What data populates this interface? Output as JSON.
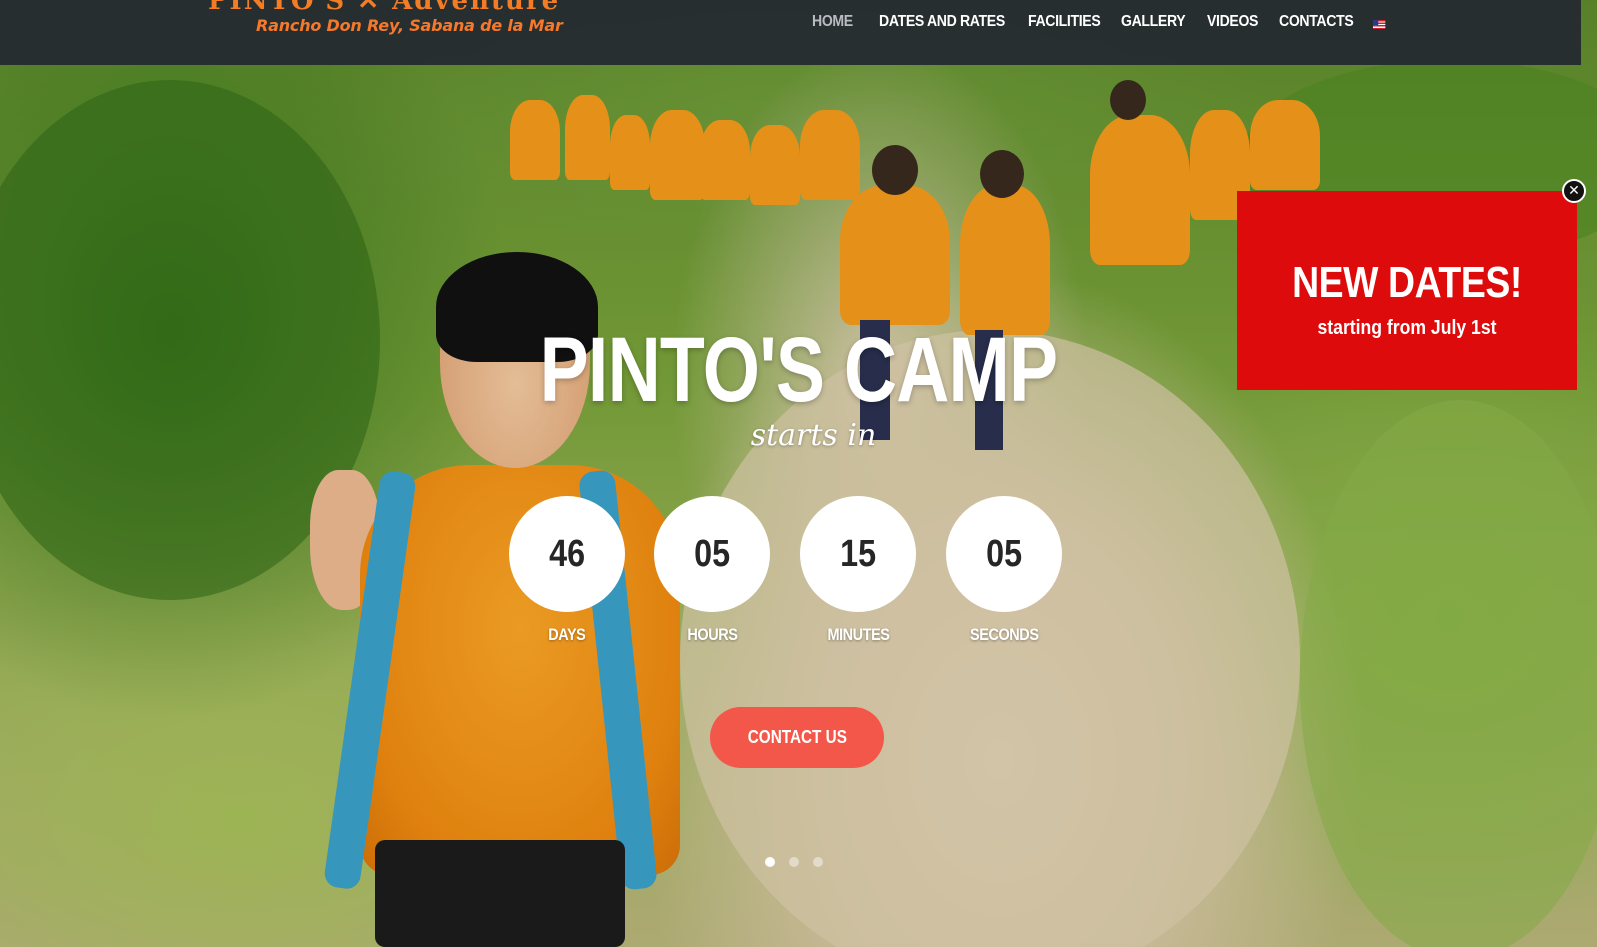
{
  "header": {
    "logo_sub": "Rancho Don Rey, Sabana de la Mar",
    "nav": [
      {
        "label": "HOME",
        "active": true
      },
      {
        "label": "DATES AND RATES",
        "active": false
      },
      {
        "label": "FACILITIES",
        "active": false
      },
      {
        "label": "GALLERY",
        "active": false
      },
      {
        "label": "VIDEOS",
        "active": false
      },
      {
        "label": "CONTACTS",
        "active": false
      }
    ],
    "language_icon": "us-flag-icon"
  },
  "hero": {
    "title": "PINTO'S CAMP",
    "subtitle": "starts in",
    "countdown": [
      {
        "value": "46",
        "label": "DAYS"
      },
      {
        "value": "05",
        "label": "HOURS"
      },
      {
        "value": "15",
        "label": "MINUTES"
      },
      {
        "value": "05",
        "label": "SECONDS"
      }
    ],
    "cta_label": "CONTACT US",
    "slider_dots": 3,
    "active_slide": 1
  },
  "promo": {
    "title": "NEW DATES!",
    "subtitle": "starting from July 1st",
    "close_icon": "close-icon",
    "color": "#dd0b0b"
  },
  "colors": {
    "topbar": "#232830",
    "accent": "#f47c24",
    "cta": "#f2574a",
    "promo": "#dd0b0b"
  }
}
